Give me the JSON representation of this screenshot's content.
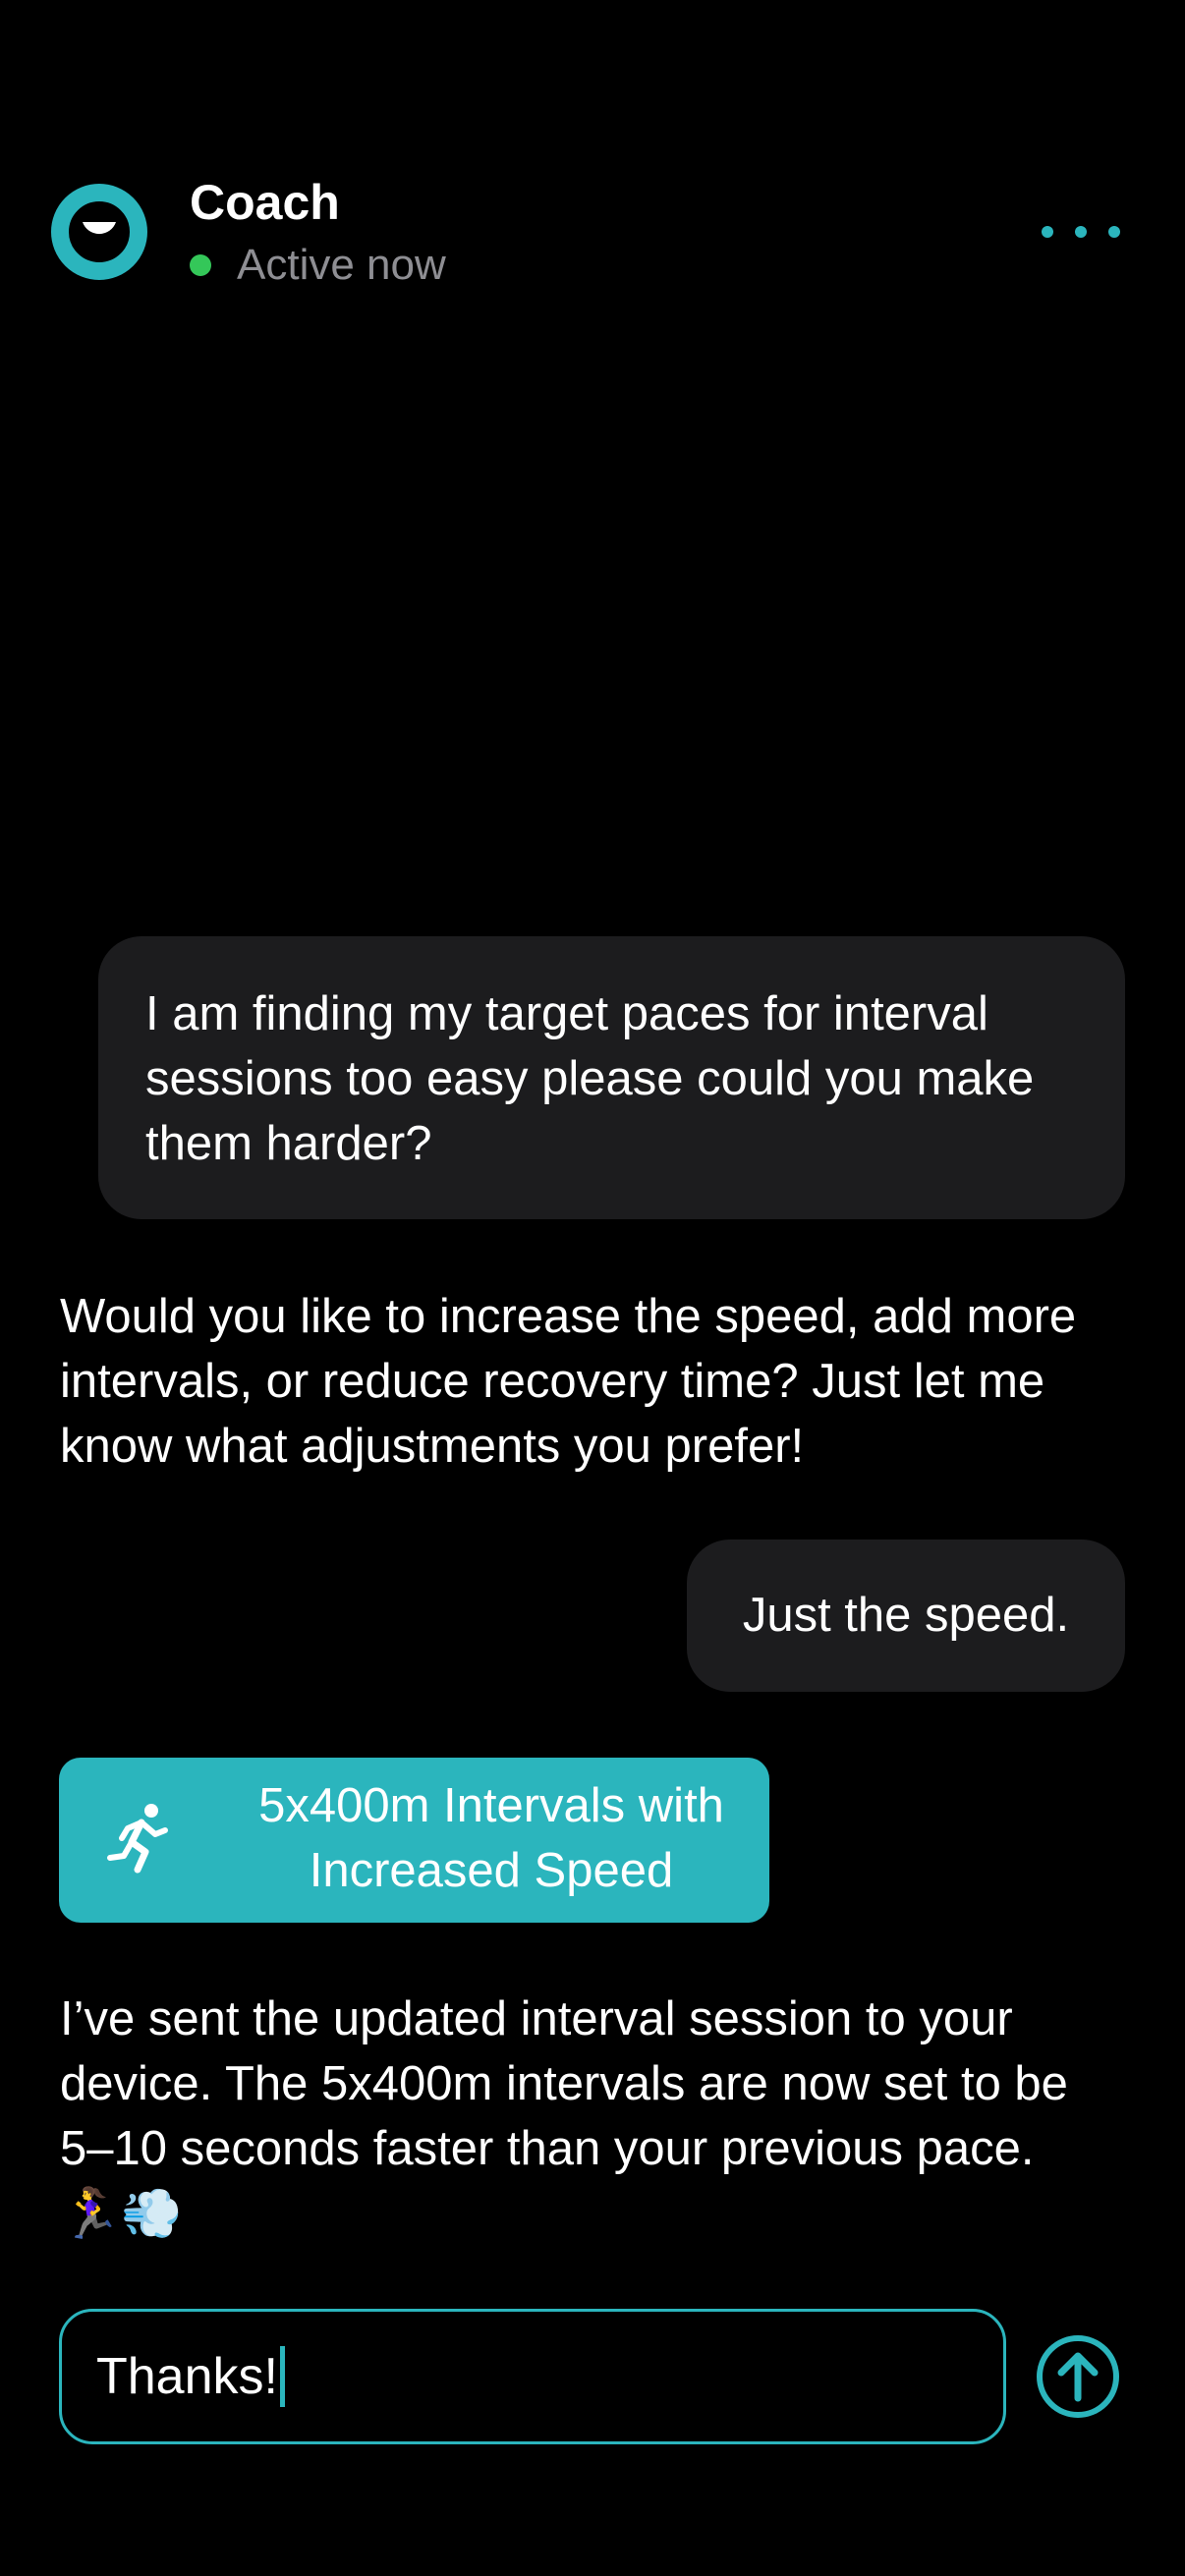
{
  "header": {
    "name": "Coach",
    "status": "Active now",
    "status_color": "#34c759",
    "menu_icon": "more-horizontal-icon"
  },
  "colors": {
    "accent": "#2bb5bd",
    "background": "#000000",
    "bubble": "#1c1c1e",
    "muted_text": "#8e8e93"
  },
  "messages": [
    {
      "sender": "user",
      "text": "I am finding my target paces for interval sessions too easy please could you make them harder?"
    },
    {
      "sender": "coach",
      "text": "Would you like to increase the speed, add more intervals, or reduce recovery time? Just let me know what adjustments you prefer!"
    },
    {
      "sender": "user",
      "text": "Just the speed."
    },
    {
      "sender": "coach",
      "type": "workout-card",
      "icon": "runner-icon",
      "title": "5x400m Intervals with Increased Speed"
    },
    {
      "sender": "coach",
      "text": "I’ve sent the updated interval session to your device. The 5x400m intervals are now set to be 5–10 seconds faster than your previous pace.",
      "emojis": "🏃‍♀️💨"
    }
  ],
  "composer": {
    "value": "Thanks!",
    "send_icon": "arrow-up-circle-icon"
  }
}
